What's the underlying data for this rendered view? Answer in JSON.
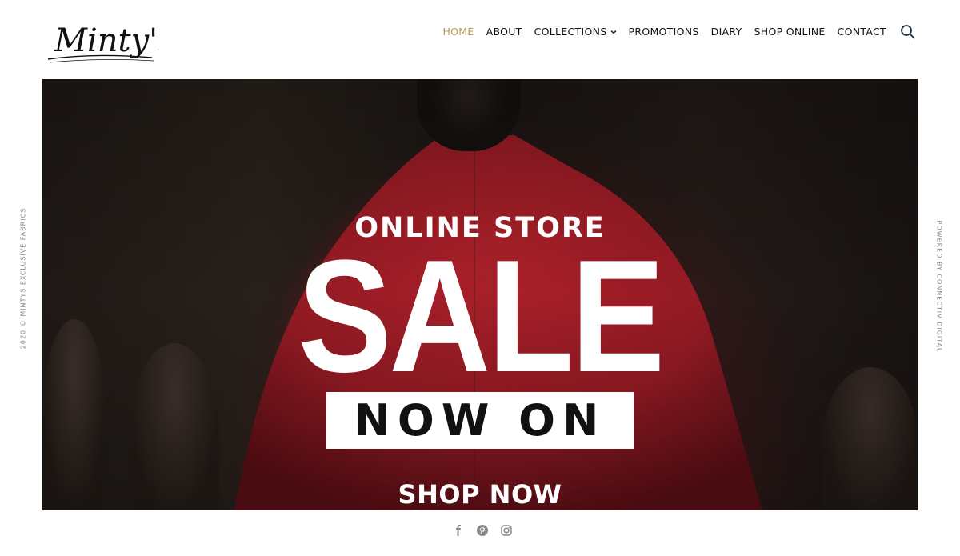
{
  "brand": {
    "logo_text": "Minty's"
  },
  "nav": {
    "items": [
      {
        "label": "HOME",
        "active": true
      },
      {
        "label": "ABOUT"
      },
      {
        "label": "COLLECTIONS",
        "has_dropdown": true
      },
      {
        "label": "PROMOTIONS"
      },
      {
        "label": "DIARY"
      },
      {
        "label": "SHOP ONLINE"
      },
      {
        "label": "CONTACT"
      }
    ],
    "search_icon": "search-icon"
  },
  "hero": {
    "line1": "ONLINE STORE",
    "line2": "SALE",
    "line3": "NOW ON",
    "cta": "SHOP NOW"
  },
  "side": {
    "left": "2020 © MINTYS EXCLUSIVE FABRICS",
    "right": "POWERED BY CONNECTIV DIGITAL"
  },
  "social": [
    "facebook-icon",
    "pinterest-icon",
    "instagram-icon"
  ],
  "colors": {
    "accent": "#b89a5c",
    "text": "#111111",
    "cloak_red": "#a51e28"
  }
}
